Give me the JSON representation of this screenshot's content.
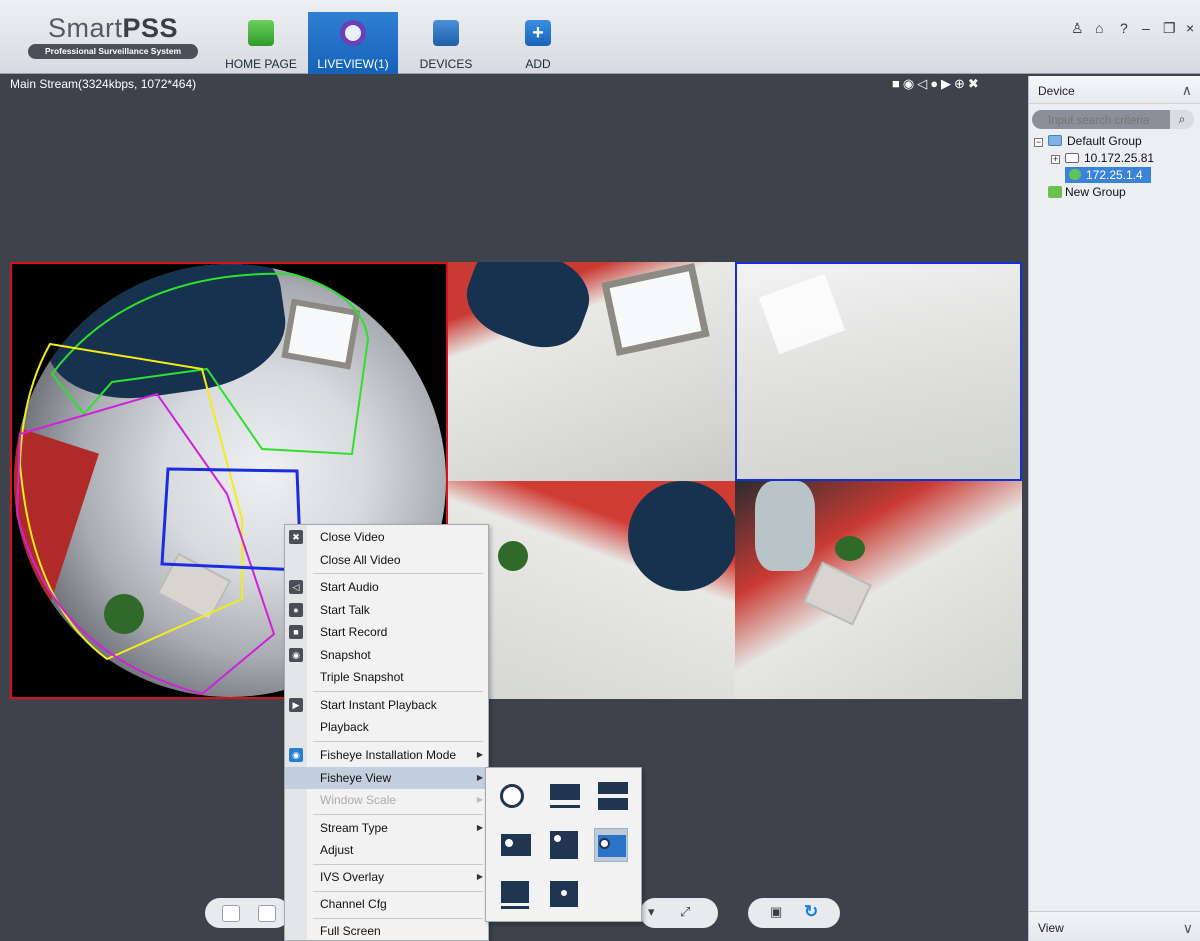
{
  "app": {
    "logo_title_light": "Smart",
    "logo_title_bold": "PSS",
    "logo_subtitle": "Professional Surveillance System"
  },
  "nav": {
    "home_label": "HOME PAGE",
    "liveview_label": "LIVEVIEW(1)",
    "devices_label": "DEVICES",
    "add_label": "ADD",
    "add_icon_glyph": "+"
  },
  "window_controls": {
    "user": "♙",
    "lock": "⌂",
    "help": "?",
    "minimize": "–",
    "restore": "❐",
    "close": "×"
  },
  "liveview": {
    "stream_info": "Main Stream(3324kbps, 1072*464)",
    "toolbar_glyphs": "■◉◁●▶⊕✖"
  },
  "side_panel": {
    "header": "Device",
    "header_chevron": "∧",
    "search_placeholder": "Input search criteria",
    "search_glyph": "⌕",
    "tree": {
      "group1_expander": "−",
      "group1_label": "Default Group",
      "device1_expander": "+",
      "device1_label": "10.172.25.81",
      "device2_label": "172.25.1.4",
      "new_group_label": "New Group"
    },
    "footer": "View",
    "footer_chevron": "∨"
  },
  "bottom": {
    "fullscreen_glyph": "⤢",
    "dropdown_glyph": "▾",
    "save_glyph": "▣",
    "refresh_glyph": "↻"
  },
  "context_menu": {
    "icon_close": "✖",
    "icon_audio": "◁",
    "icon_talk": "●",
    "icon_record": "■",
    "icon_snapshot": "◉",
    "icon_playback": "▶",
    "icon_fisheye": "◉",
    "submenu_arrow": "▶",
    "items": {
      "close_video": "Close Video",
      "close_all_video": "Close All Video",
      "start_audio": "Start Audio",
      "start_talk": "Start Talk",
      "start_record": "Start Record",
      "snapshot": "Snapshot",
      "triple_snapshot": "Triple Snapshot",
      "start_instant_playback": "Start Instant Playback",
      "playback": "Playback",
      "fisheye_installation_mode": "Fisheye Installation Mode",
      "fisheye_view": "Fisheye View",
      "window_scale": "Window Scale",
      "stream_type": "Stream Type",
      "adjust": "Adjust",
      "ivs_overlay": "IVS Overlay",
      "channel_cfg": "Channel Cfg",
      "full_screen": "Full Screen"
    }
  },
  "colors": {
    "active_tab": "#1f6fc7",
    "selected_pane_border": "#d8121b",
    "pane_highlight_border": "#1230d8",
    "menu_highlight": "#c3cede",
    "tree_selection": "#3b83d9"
  }
}
